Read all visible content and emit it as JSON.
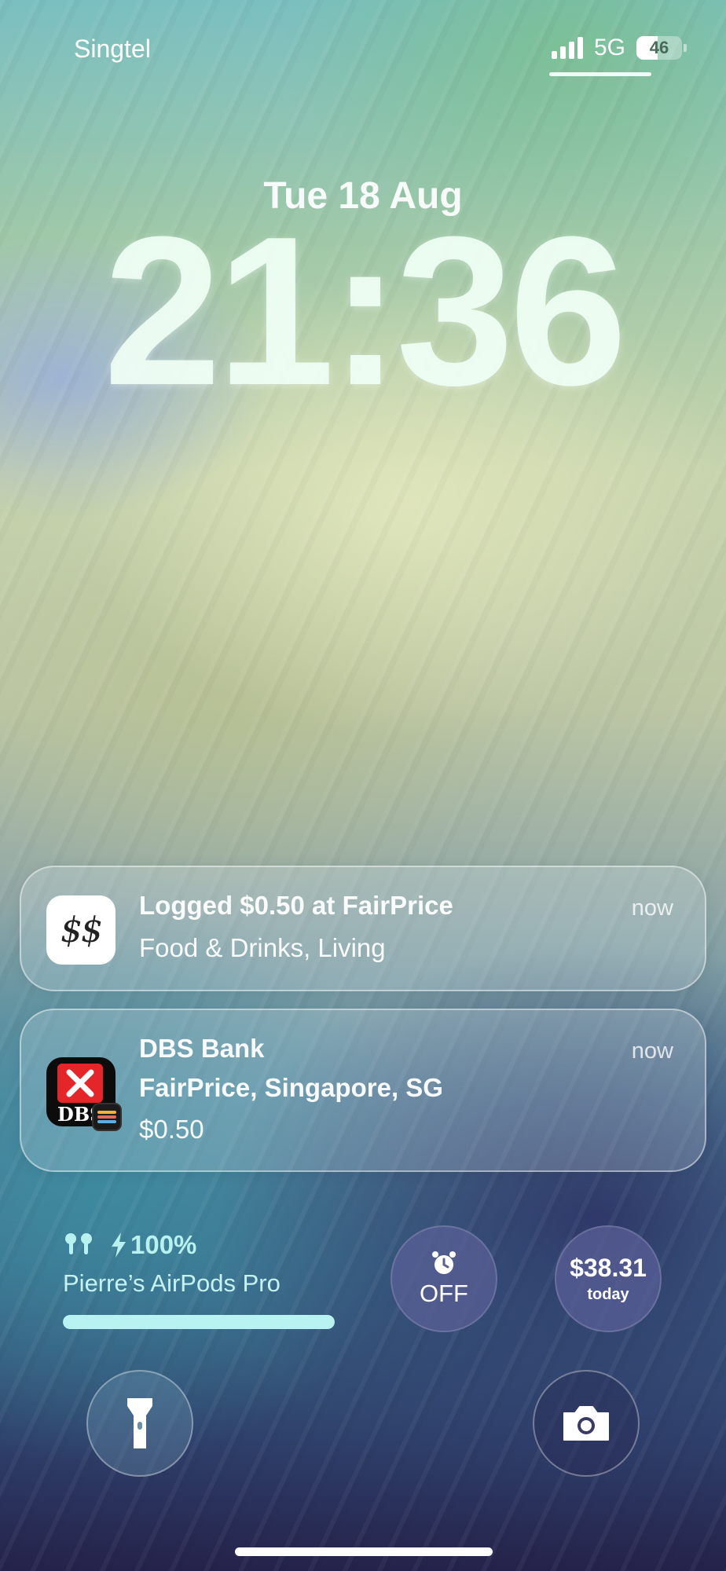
{
  "status_bar": {
    "carrier": "Singtel",
    "network": "5G",
    "battery_level": "46",
    "signal_bars": 4
  },
  "lock_screen": {
    "date": "Tue 18 Aug",
    "time": "21:36"
  },
  "notifications": [
    {
      "app_icon": "dollar-sign-app-icon",
      "icon_text": "$$",
      "title": "Logged $0.50 at FairPrice",
      "body": "Food & Drinks, Living",
      "time": "now"
    },
    {
      "app_icon": "dbs-bank-icon",
      "icon_text": "DBS",
      "title": "DBS Bank",
      "body_line1": "FairPrice, Singapore, SG",
      "body_line2": "$0.50",
      "time": "now"
    }
  ],
  "widgets": {
    "airpods": {
      "battery": "100%",
      "battery_fraction": 1.0,
      "name": "Pierre’s AirPods Pro",
      "color": "#b8f3f2"
    },
    "alarm": {
      "icon": "alarm-clock-icon",
      "label": "OFF"
    },
    "spending": {
      "value": "$38.31",
      "subtitle": "today"
    }
  },
  "quick_actions": {
    "left": "flashlight-icon",
    "right": "camera-icon"
  }
}
